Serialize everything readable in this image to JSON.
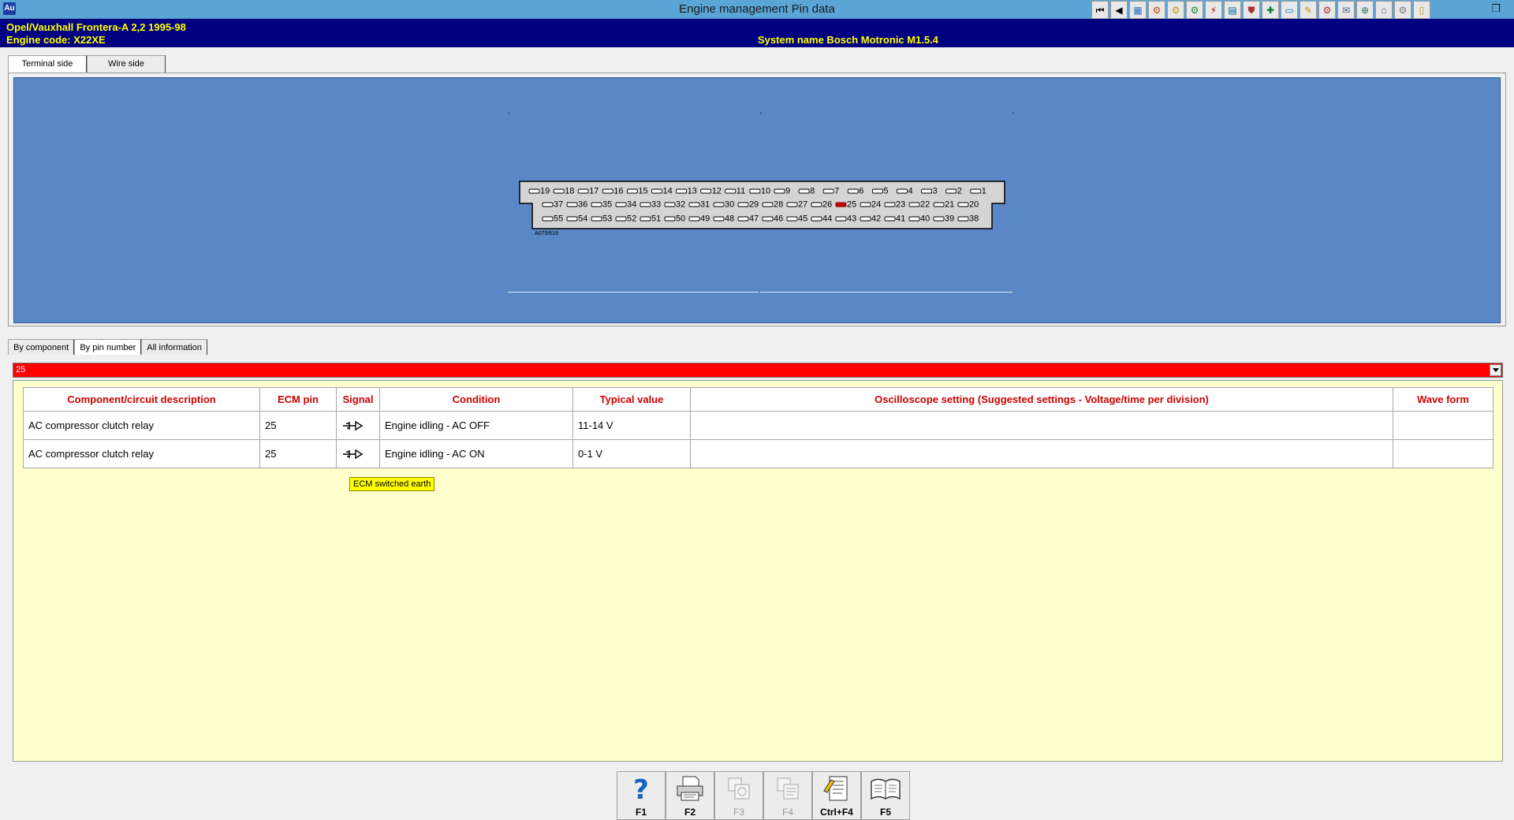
{
  "window": {
    "title": "Engine management Pin data",
    "app_icon": "Au"
  },
  "toolbar": {
    "buttons": [
      {
        "name": "first-page-icon",
        "glyph": "⏮"
      },
      {
        "name": "back-icon",
        "glyph": "◀"
      },
      {
        "name": "tool-icon-1",
        "glyph": "▦"
      },
      {
        "name": "tool-icon-2",
        "glyph": "⚙"
      },
      {
        "name": "tool-icon-3",
        "glyph": "⚙"
      },
      {
        "name": "tool-icon-4",
        "glyph": "⚙"
      },
      {
        "name": "tool-icon-5",
        "glyph": "⚡"
      },
      {
        "name": "tool-icon-6",
        "glyph": "▤"
      },
      {
        "name": "tool-icon-7",
        "glyph": "⛊"
      },
      {
        "name": "tool-icon-8",
        "glyph": "✚"
      },
      {
        "name": "tool-icon-9",
        "glyph": "▭"
      },
      {
        "name": "tool-icon-10",
        "glyph": "✎"
      },
      {
        "name": "tool-icon-11",
        "glyph": "⚙"
      },
      {
        "name": "tool-icon-12",
        "glyph": "✉"
      },
      {
        "name": "tool-icon-13",
        "glyph": "⊕"
      },
      {
        "name": "tool-icon-14",
        "glyph": "⌂"
      },
      {
        "name": "tool-icon-15",
        "glyph": "⚙"
      },
      {
        "name": "tool-icon-16",
        "glyph": "▯"
      }
    ],
    "restore_glyph": "❐"
  },
  "header": {
    "vehicle": "Opel/Vauxhall   Frontera-A 2,2  1995-98",
    "engine_code": "Engine code: X22XE",
    "system_name": "System name Bosch Motronic M1.5.4"
  },
  "diagram_tabs": [
    "Terminal side",
    "Wire side"
  ],
  "connector": {
    "label": "A075/616",
    "row1": [
      "19",
      "18",
      "17",
      "16",
      "15",
      "14",
      "13",
      "12",
      "11",
      "10",
      "9",
      "8",
      "7",
      "6",
      "5",
      "4",
      "3",
      "2",
      "1"
    ],
    "row2": [
      "37",
      "36",
      "35",
      "34",
      "33",
      "32",
      "31",
      "30",
      "29",
      "28",
      "27",
      "26",
      "25",
      "24",
      "23",
      "22",
      "21",
      "20"
    ],
    "row3": [
      "55",
      "54",
      "53",
      "52",
      "51",
      "50",
      "49",
      "48",
      "47",
      "46",
      "45",
      "44",
      "43",
      "42",
      "41",
      "40",
      "39",
      "38"
    ],
    "highlighted_pin": "25",
    "highlight_color": "#cc0000"
  },
  "list_tabs": [
    "By component",
    "By pin number",
    "All information"
  ],
  "selector": {
    "value": "25",
    "background": "#ff0000"
  },
  "table": {
    "headers": [
      "Component/circuit description",
      "ECM pin",
      "Signal",
      "Condition",
      "Typical value",
      "Oscilloscope setting (Suggested settings - Voltage/time per division)",
      "Wave form"
    ],
    "rows": [
      {
        "description": "AC compressor clutch relay",
        "pin": "25",
        "signal": "switched-earth",
        "condition": "Engine idling - AC OFF",
        "typical": "11-14 V",
        "scope": "",
        "wave": ""
      },
      {
        "description": "AC compressor clutch relay",
        "pin": "25",
        "signal": "switched-earth",
        "condition": "Engine idling - AC ON",
        "typical": "0-1 V",
        "scope": "",
        "wave": ""
      }
    ],
    "header_color": "#cc0000"
  },
  "tooltip": "ECM switched earth",
  "function_keys": [
    {
      "label": "F1",
      "name": "help",
      "enabled": true
    },
    {
      "label": "F2",
      "name": "print",
      "enabled": true
    },
    {
      "label": "F3",
      "name": "print-preview",
      "enabled": false
    },
    {
      "label": "F4",
      "name": "copy",
      "enabled": false
    },
    {
      "label": "Ctrl+F4",
      "name": "notes",
      "enabled": true
    },
    {
      "label": "F5",
      "name": "manual",
      "enabled": true
    }
  ]
}
